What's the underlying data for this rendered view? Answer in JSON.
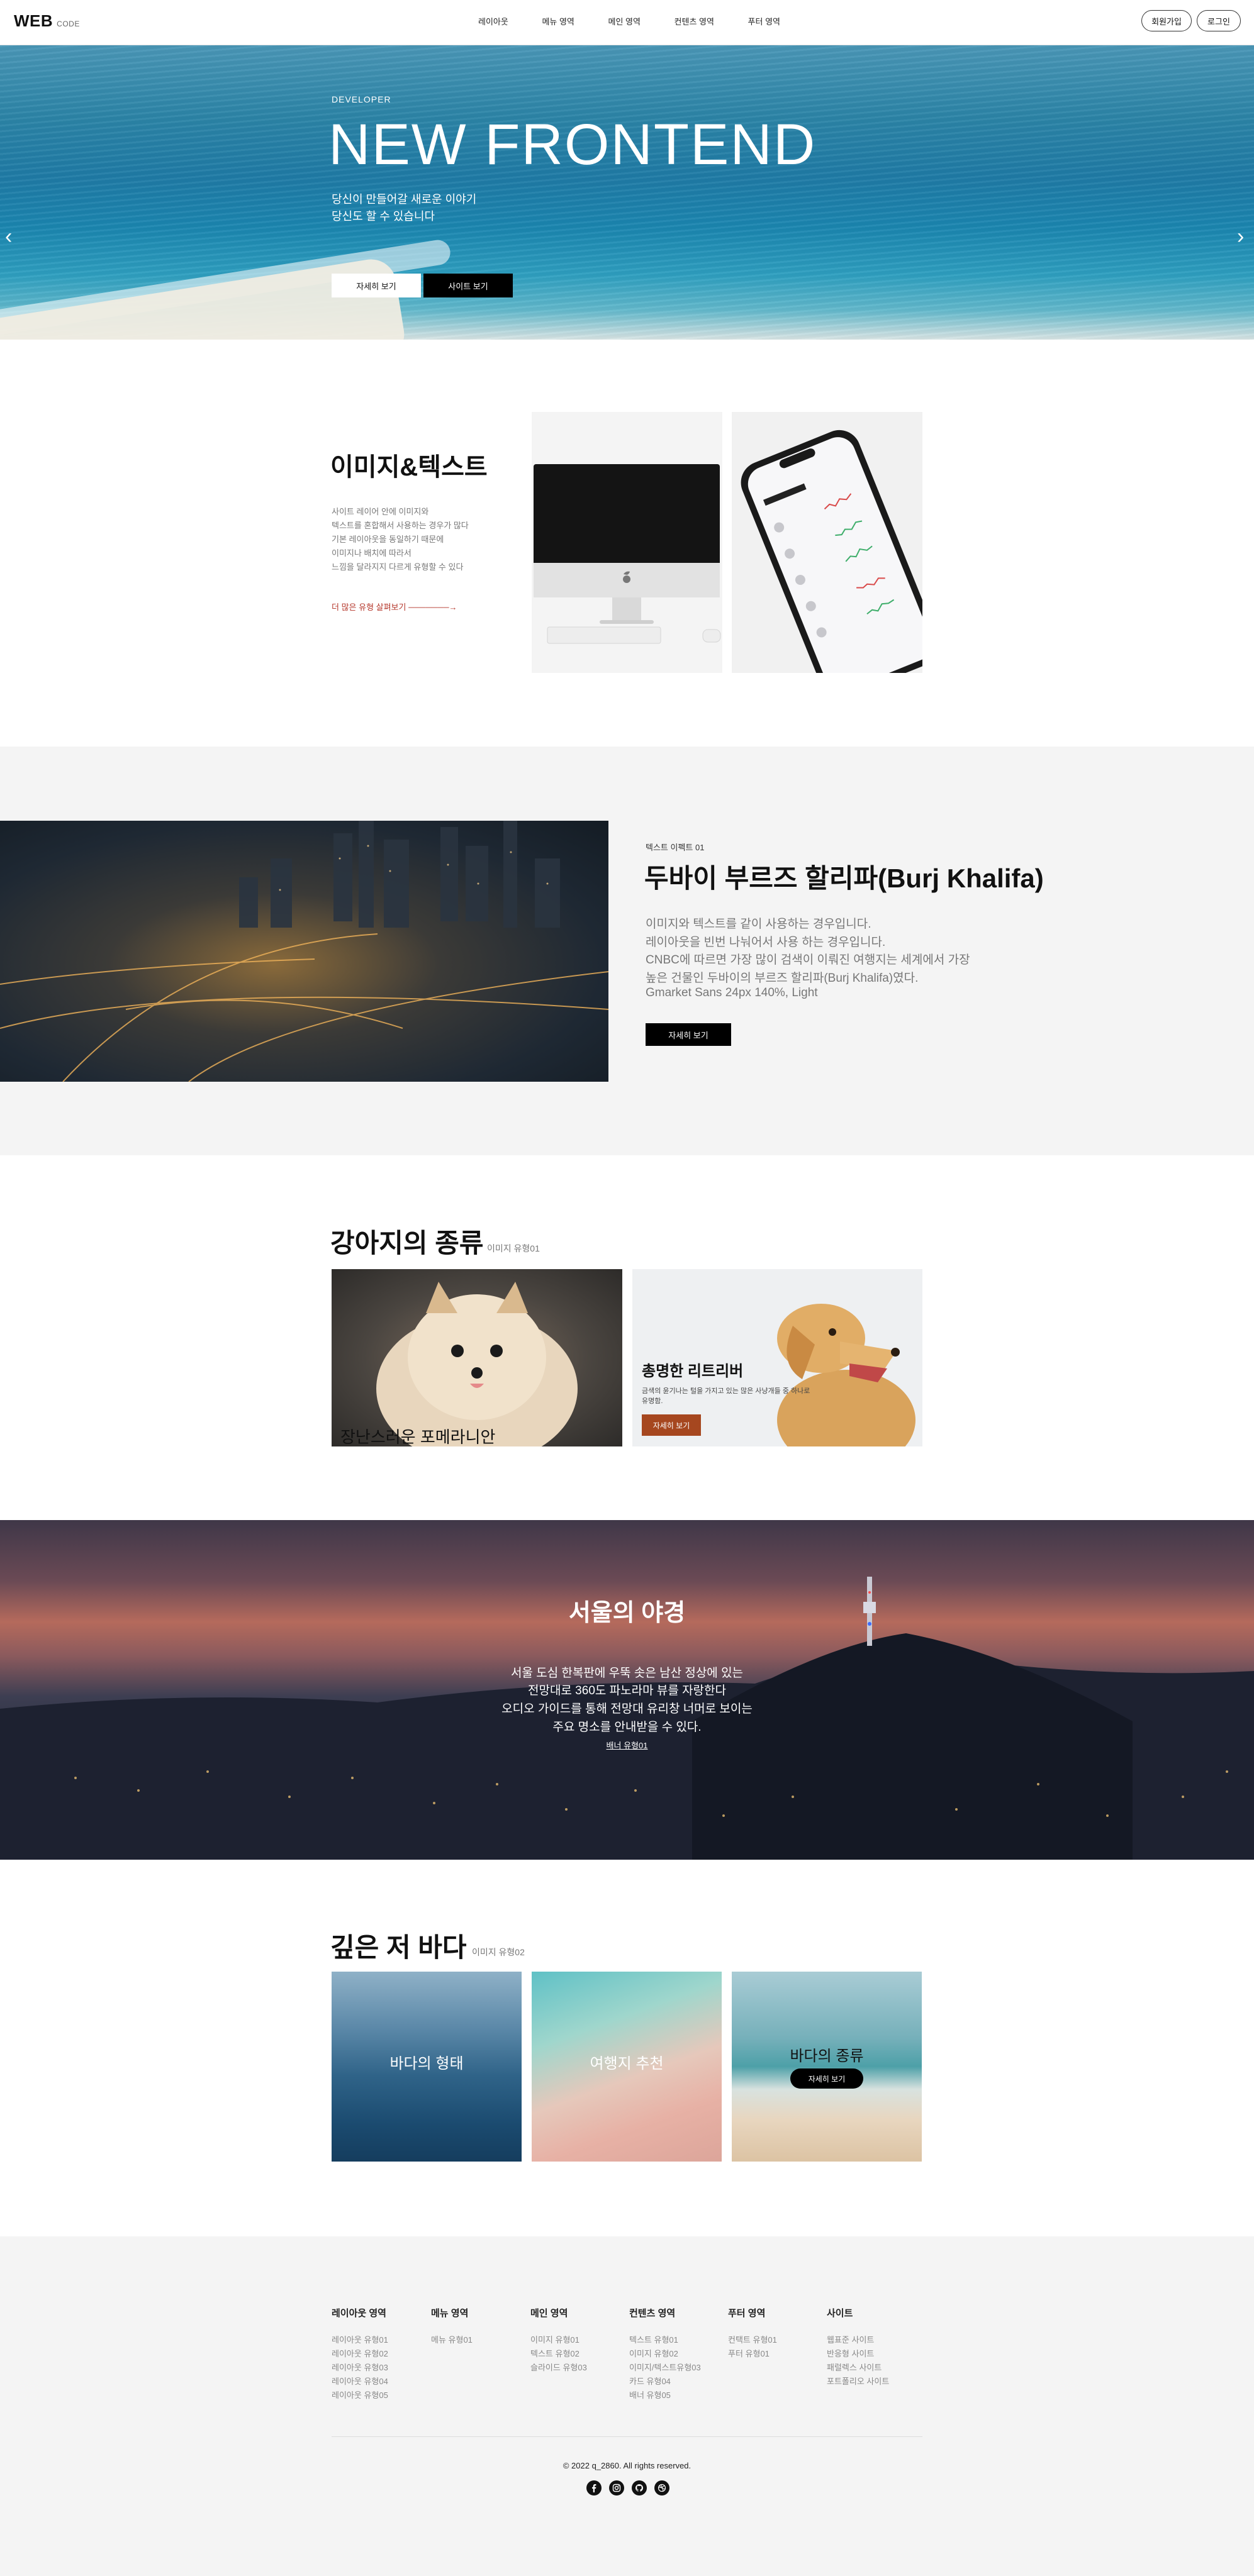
{
  "header": {
    "logo": "WEB",
    "logo_sub": "CODE",
    "nav": [
      "레이아웃",
      "메뉴 영역",
      "메인 영역",
      "컨텐츠 영역",
      "푸터 영역"
    ],
    "signup": "회원가입",
    "login": "로그인"
  },
  "hero": {
    "eyebrow": "DEVELOPER",
    "title": "NEW FRONTEND",
    "desc1": "당신이 만들어갈 새로운 이야기",
    "desc2": "당신도 할 수 있습니다",
    "btn_detail": "자세히 보기",
    "btn_site": "사이트 보기",
    "slide_count": 3,
    "active_slide": 1
  },
  "imgtext": {
    "title": "이미지&텍스트",
    "desc": [
      "사이트 레이어 안에 이미지와",
      "텍스트를 혼합해서 사용하는 경우가 많다",
      "기본 레이아웃을 동일하기 때문에",
      "이미지나 배치에 따라서",
      "느낌을 달라지지 다르게 유형할 수 있다"
    ],
    "link": "더 많은 유형 살펴보기 ───────→"
  },
  "burj": {
    "eyebrow": "텍스트 이펙트 01",
    "title": "두바이 부르즈 할리파(Burj Khalifa)",
    "lines": [
      "이미지와 텍스트를 같이 사용하는 경우입니다.",
      "레이아웃을 빈번 나눠어서 사용 하는 경우입니다.",
      "CNBC에 따르면 가장 많이 검색이 이뤄진 여행지는 세계에서 가장",
      "높은 건물인 두바이의 부르즈 할리파(Burj Khalifa)였다.",
      "Gmarket Sans 24px 140%, Light"
    ],
    "button": "자세히 보기"
  },
  "dogs": {
    "title": "강아지의 종류",
    "sub": "이미지 유형01",
    "card1_label": "장난스러운 포메라니안",
    "card2_title": "총명한 리트리버",
    "card2_desc1": "금색의 윤기나는 털을 가지고 있는 많은 사냥개들 중 하나로",
    "card2_desc2": "유명함.",
    "card2_button": "자세히 보기"
  },
  "seoul": {
    "title": "서울의 야경",
    "lines": [
      "서울 도심 한복판에 우뚝 솟은 남산 정상에 있는",
      "전망대로 360도 파노라마 뷰를 자랑한다",
      "오디오 가이드를 통해 전망대 유리창 너머로 보이는",
      "주요 명소를 안내받을 수 있다."
    ],
    "link": "배너 유형01"
  },
  "sea": {
    "title": "깊은 저 바다",
    "sub": "이미지 유형02",
    "card1": "바다의 형태",
    "card2": "여행지 추천",
    "card3": "바다의 종류",
    "card3_button": "자세히 보기"
  },
  "footer": {
    "columns": [
      {
        "title": "레이아웃 영역",
        "items": [
          "레이아웃 유형01",
          "레이아웃 유형02",
          "레이아웃 유형03",
          "레이아웃 유형04",
          "레이아웃 유형05"
        ]
      },
      {
        "title": "메뉴 영역",
        "items": [
          "메뉴 유형01"
        ]
      },
      {
        "title": "메인 영역",
        "items": [
          "이미지 유형01",
          "텍스트 유형02",
          "슬라이드 유형03"
        ]
      },
      {
        "title": "컨텐츠 영역",
        "items": [
          "텍스트 유형01",
          "이미지 유형02",
          "이미지/텍스트유형03",
          "카드 유형04",
          "배너 유형05"
        ]
      },
      {
        "title": "푸터 영역",
        "items": [
          "컨택트 유형01",
          "푸터 유형01"
        ]
      },
      {
        "title": "사이트",
        "items": [
          "웹표준 사이트",
          "반응형 사이트",
          "패럴렉스 사이트",
          "포트폴리오 사이트"
        ]
      }
    ],
    "copyright": "© 2022 q_2860. All rights reserved.",
    "social": [
      "facebook-icon",
      "instagram-icon",
      "github-icon",
      "dribbble-icon"
    ]
  }
}
